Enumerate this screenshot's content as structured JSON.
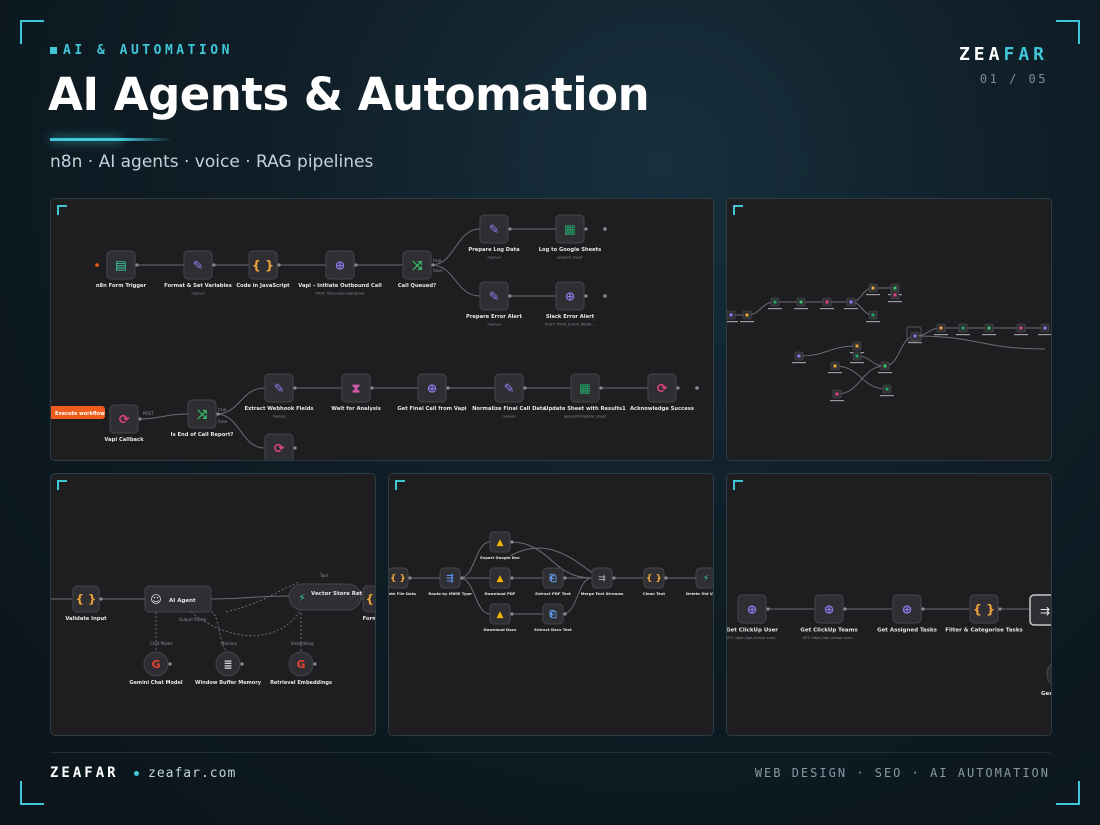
{
  "header": {
    "eyebrow": "AI & AUTOMATION",
    "title": "AI Agents & Automation",
    "subtitle": "n8n · AI agents · voice · RAG pipelines",
    "brand_main": "ZEA",
    "brand_accent": "FAR",
    "pager": "01 / 05"
  },
  "footer": {
    "brand": "ZEAFAR",
    "url": "zeafar.com",
    "tags": "WEB DESIGN · SEO · AI AUTOMATION"
  },
  "colors": {
    "accent": "#3fc6d8",
    "panel_bg": "#1e1e21",
    "node_bg": "#2f2f33",
    "execute_button": "#ef5b1c"
  },
  "panel_vapi": {
    "execute_button": "Execute workflow",
    "nodes": [
      {
        "name": "n8n Form Trigger",
        "sub": "",
        "icon": "form-icon"
      },
      {
        "name": "Format & Set Variables",
        "sub": "manual",
        "icon": "edit-icon"
      },
      {
        "name": "Code in JavaScript",
        "sub": "",
        "icon": "code-icon"
      },
      {
        "name": "Vapi – Initiate Outbound Call",
        "sub": "POST: https://api.vapi.ai/call",
        "icon": "globe-icon"
      },
      {
        "name": "Call Queued?",
        "sub": "",
        "icon": "if-icon"
      },
      {
        "name": "Prepare Log Data",
        "sub": "manual",
        "icon": "edit-icon"
      },
      {
        "name": "Log to Google Sheets",
        "sub": "append: sheet",
        "icon": "sheets-icon"
      },
      {
        "name": "Prepare Error Alert",
        "sub": "manual",
        "icon": "edit-icon"
      },
      {
        "name": "Slack Error Alert",
        "sub": "POST: YOUR_SLACK_WEBH...",
        "icon": "globe-icon"
      },
      {
        "name": "Vapi Callback",
        "sub": "",
        "icon": "webhook-icon"
      },
      {
        "name": "Is End of Call Report?",
        "sub": "",
        "icon": "if-icon"
      },
      {
        "name": "Extract Webhook Fields",
        "sub": "manual",
        "icon": "edit-icon"
      },
      {
        "name": "Wait for Analysis",
        "sub": "",
        "icon": "hourglass-icon"
      },
      {
        "name": "Get Final Call from Vapi",
        "sub": "",
        "icon": "globe-icon"
      },
      {
        "name": "Normalize Final Call Data",
        "sub": "manual",
        "icon": "edit-icon"
      },
      {
        "name": "Update Sheet with Results1",
        "sub": "appendOrUpdate: sheet",
        "icon": "sheets-icon"
      },
      {
        "name": "Acknowledge Success",
        "sub": "",
        "icon": "webhook-icon"
      }
    ],
    "branch_labels": {
      "true": "true",
      "false": "false",
      "post": "POST"
    }
  },
  "panel_rag": {
    "nodes": [
      {
        "name": "Validate Input",
        "icon": "code-icon"
      },
      {
        "name": "AI Agent",
        "icon": "robot-icon"
      },
      {
        "name": "Vector Store Retriever",
        "icon": "vector-icon"
      },
      {
        "name": "Format R",
        "icon": "code-icon"
      },
      {
        "name": "Gemini Chat Model",
        "icon": "google-icon"
      },
      {
        "name": "Window Buffer Memory",
        "icon": "memory-icon"
      },
      {
        "name": "Retrieval Embeddings",
        "icon": "google-icon"
      }
    ],
    "ports": [
      "Chat Model",
      "Memory",
      "Tool",
      "Embedding",
      "Output Parser"
    ]
  },
  "panel_drive": {
    "nodes": [
      {
        "name": "Update File Data",
        "icon": "code-icon"
      },
      {
        "name": "Route by MIME Type",
        "icon": "switch-icon"
      },
      {
        "name": "Export Google Doc",
        "icon": "drive-icon"
      },
      {
        "name": "Download PDF",
        "icon": "drive-icon"
      },
      {
        "name": "Download Docx",
        "icon": "drive-icon"
      },
      {
        "name": "Extract PDF Text",
        "icon": "extract-icon"
      },
      {
        "name": "Extract Docx Text",
        "icon": "extract-icon"
      },
      {
        "name": "Merge Text Streams",
        "icon": "merge-icon"
      },
      {
        "name": "Clean Text",
        "icon": "code-icon"
      },
      {
        "name": "Delete Old Vectors",
        "icon": "vector-icon"
      }
    ]
  },
  "panel_clickup": {
    "nodes": [
      {
        "name": "Get ClickUp User",
        "sub": "GET: https://api.clickup.com/...",
        "icon": "globe-icon"
      },
      {
        "name": "Get ClickUp Teams",
        "sub": "GET: https://api.clickup.com/...",
        "icon": "globe-icon"
      },
      {
        "name": "Get Assigned Tasks",
        "sub": "",
        "icon": "globe-icon"
      },
      {
        "name": "Filter & Categorise Tasks",
        "sub": "",
        "icon": "code-icon"
      },
      {
        "name": "Gen",
        "sub": "",
        "icon": "merge-icon"
      }
    ]
  }
}
